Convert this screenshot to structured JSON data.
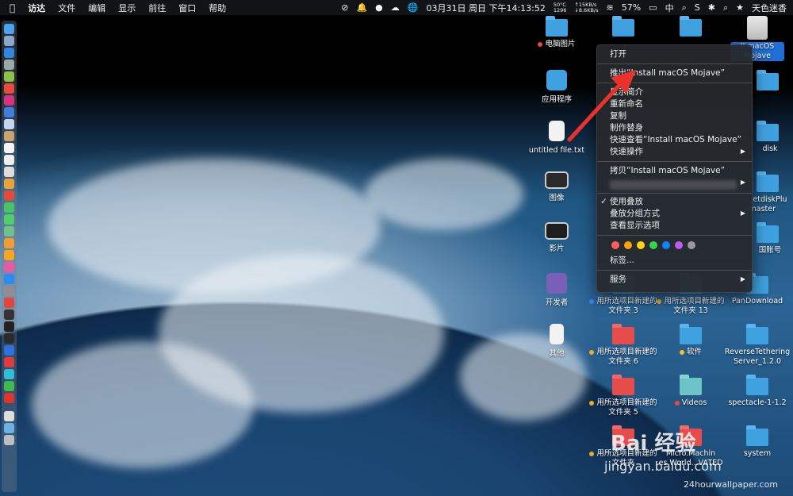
{
  "menubar": {
    "apple_icon": "apple-icon",
    "menus": [
      "访达",
      "文件",
      "编辑",
      "显示",
      "前往",
      "窗口",
      "帮助"
    ],
    "status": {
      "cpu_temp": "50°C",
      "cpu_percent": "1296",
      "net_up": "↑15KB/s",
      "net_down": "↓8.6KB/s",
      "datetime": "03月31日 周日 下午14:13:52",
      "battery": "57%",
      "input_method": "中",
      "user": "天色迷香"
    }
  },
  "desktop_items": [
    {
      "label": "电脑图片",
      "tag": "#e74c3c"
    },
    {
      "label": "应用程序"
    },
    {
      "label": "untitled file.txt"
    },
    {
      "label": "图像"
    },
    {
      "label": "影片"
    },
    {
      "label": "开发者"
    },
    {
      "label": "其他"
    },
    {
      "label": "用所选项目新建的文件夹 3",
      "tag": "#3b82f6"
    },
    {
      "label": "用所选项目新建的文件夹 13",
      "tag": "#f5a623"
    },
    {
      "label": "用所选项目新建的文件夹 6",
      "tag": "#f5a623"
    },
    {
      "label": "软件",
      "tag": "#f5c518"
    },
    {
      "label": "用所选项目新建的文件夹 5",
      "tag": "#f5a623"
    },
    {
      "label": "Videos",
      "tag": "#e74c3c"
    },
    {
      "label": "用所选项目新建的文件夹",
      "tag": "#f5a623"
    },
    {
      "label": "Micro.Machin es.World...VATED"
    },
    {
      "label": "PanDownload"
    },
    {
      "label": "ReverseTethering Server_1.2.0"
    },
    {
      "label": "spectacle-1-1.2"
    },
    {
      "label": "system"
    },
    {
      "label": "II macOS Mojave"
    },
    {
      "label": "disk"
    },
    {
      "label": "etdiskPlu ...-master"
    },
    {
      "label": "国账号"
    }
  ],
  "context_menu": {
    "open": "打开",
    "eject": "推出“Install macOS Mojave”",
    "get_info": "显示简介",
    "rename": "重新命名",
    "duplicate": "复制",
    "make_alias": "制作替身",
    "quick_look": "快速查看“Install macOS Mojave”",
    "quick_actions": "快速操作",
    "copy": "拷贝“Install macOS Mojave”",
    "use_stacks": "使用叠放",
    "group_stacks_by": "叠放分组方式",
    "show_view_options": "查看显示选项",
    "tags_label": "标签...",
    "services": "服务",
    "tag_colors": [
      "#ff5f57",
      "#ff9f0a",
      "#ffd60a",
      "#32d74b",
      "#0a84ff",
      "#bf5af2",
      "#98989d"
    ]
  },
  "annotation": {
    "color": "#e8322b"
  },
  "watermarks": {
    "baidu": "Bai 经验",
    "baidu_url": "jingyan.baidu.com",
    "wallpaper": "24hourwallpaper.com"
  }
}
